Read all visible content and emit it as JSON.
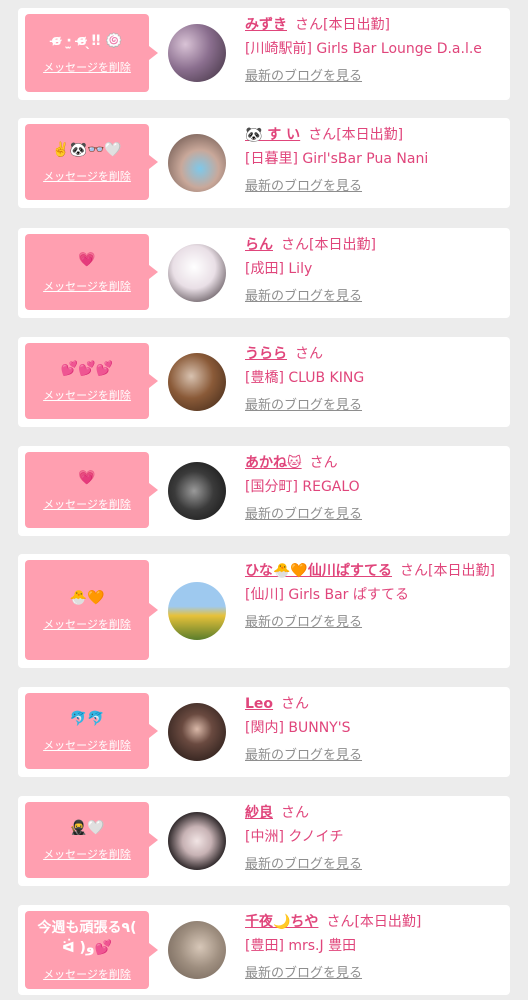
{
  "delete_label": "メッセージを削除",
  "blog_label": "最新のブログを見る",
  "san_label": "さん",
  "colors": {
    "accent": "#e0457b",
    "bubble": "#ff9fb0",
    "background": "#ececec"
  },
  "cards": [
    {
      "message": "ɞ̴̶̷ ·̫ ɞ̴̶̷ ̖‼︎ 🍥",
      "name": "みずき",
      "status": "[本日出勤]",
      "shop": "[川崎駅前] Girls Bar Lounge D.a.l.e"
    },
    {
      "message": "✌️🐼👓🤍",
      "name": "🐼 す い",
      "status": "[本日出勤]",
      "shop": "[日暮里] Girl'sBar Pua Nani"
    },
    {
      "message": "💗",
      "name": "らん",
      "status": "[本日出勤]",
      "shop": "[成田] Lily"
    },
    {
      "message": "💕💕💕",
      "name": "うらら",
      "status": "",
      "shop": "[豊橋] CLUB KING"
    },
    {
      "message": "💗",
      "name": "あかね🐱",
      "status": "",
      "shop": "[国分町] REGALO"
    },
    {
      "message": "🐣🧡",
      "name": "ひな🐣🧡仙川ぱすてる",
      "status": "[本日出勤]",
      "shop": "[仙川] Girls Bar ぱすてる"
    },
    {
      "message": "🐬🐬",
      "name": "Leo",
      "status": "",
      "shop": "[関内] BUNNY'S"
    },
    {
      "message": "🥷🤍",
      "name": "紗良",
      "status": "",
      "shop": "[中洲] クノイチ"
    },
    {
      "message": "今週も頑張る٩( ᐛ )و💕",
      "name": "千夜🌙ちや",
      "status": "[本日出勤]",
      "shop": "[豊田] mrs.J 豊田"
    }
  ]
}
